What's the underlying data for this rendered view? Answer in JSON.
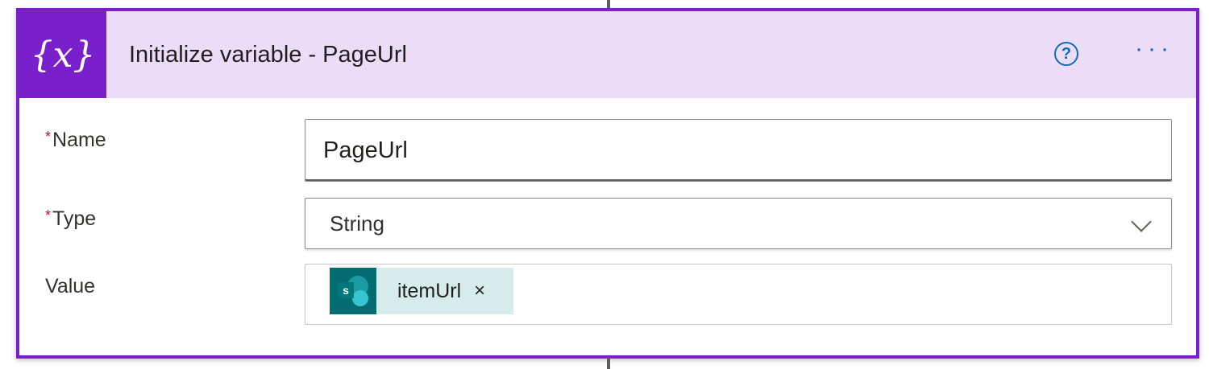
{
  "action": {
    "icon_glyph": "{x}",
    "icon": "variable-icon",
    "title": "Initialize variable - PageUrl",
    "help_glyph": "?",
    "more_glyph": "···",
    "accent_color": "#7a1fcc",
    "header_bg_color": "#ecdcf7"
  },
  "fields": {
    "name": {
      "required_mark": "*",
      "label": "Name",
      "value": "PageUrl"
    },
    "type": {
      "required_mark": "*",
      "label": "Type",
      "selected": "String"
    },
    "value": {
      "label": "Value",
      "token": {
        "icon": "sharepoint-icon",
        "icon_letter": "s",
        "text": "itemUrl",
        "close_glyph": "×",
        "token_bg_color": "#d5ecea",
        "icon_bg_color": "#036c70"
      }
    }
  }
}
